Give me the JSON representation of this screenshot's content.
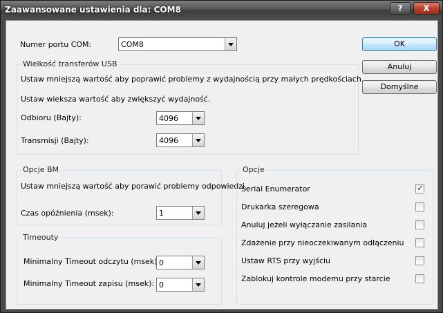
{
  "window": {
    "title": "Zaawansowane ustawienia dla: COM8",
    "help_label": "?",
    "close_label": "X"
  },
  "com_port": {
    "label": "Numer portu COM:",
    "value": "COM8"
  },
  "usb": {
    "title": "Wielkość transferów USB",
    "hint_low": "Ustaw mniejszą wartość aby poprawić problemy z wydajnością przy małych prędkościach.",
    "hint_high": "Ustaw wieksza wartość aby zwiększyć wydajność.",
    "receive_label": "Odbioru (Bajty):",
    "receive_value": "4096",
    "transmit_label": "Transmisji (Bajty):",
    "transmit_value": "4096"
  },
  "bm": {
    "title": "Opcje BM",
    "hint": "Ustaw mniejszą wartość aby porawić problemy odpowiedzi.",
    "latency_label": "Czas opóźnienia (msek):",
    "latency_value": "1"
  },
  "timeouts": {
    "title": "Timeouty",
    "read_label": "Minimalny Timeout odczytu (msek):",
    "read_value": "0",
    "write_label": "Minimalny Timeout zapisu (msek):",
    "write_value": "0"
  },
  "options": {
    "title": "Opcje",
    "items": [
      {
        "label": "Serial Enumerator",
        "checked": true
      },
      {
        "label": "Drukarka szeregowa",
        "checked": false
      },
      {
        "label": "Anuluj jeżeli wyłączanie zasilania",
        "checked": false
      },
      {
        "label": "Zdażenie przy nieoczekiwanym odłączeniu",
        "checked": false
      },
      {
        "label": "Ustaw RTS przy wyjściu",
        "checked": false
      },
      {
        "label": "Zablokuj kontrole modemu przy starcie",
        "checked": false
      }
    ]
  },
  "buttons": {
    "ok": "OK",
    "cancel": "Anuluj",
    "defaults": "Domyślne"
  },
  "icons": {
    "check": "✓"
  }
}
